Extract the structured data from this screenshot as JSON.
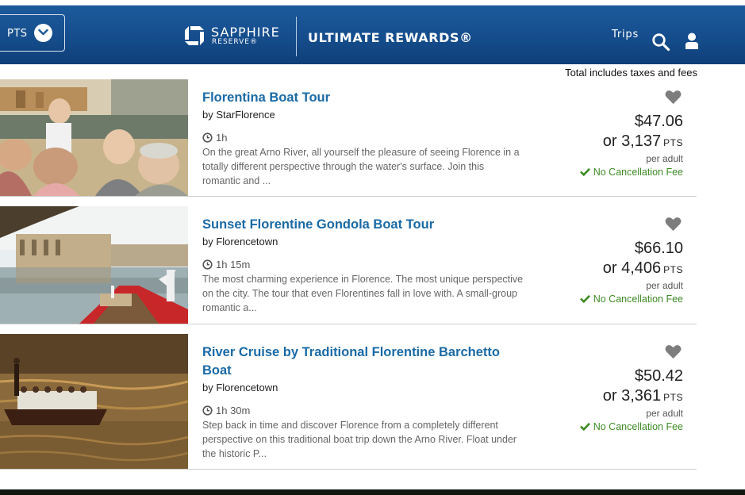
{
  "header": {
    "currency_label": "PTS",
    "brand_line1": "SAPPHIRE",
    "brand_line2": "RESERVE®",
    "program_name": "ULTIMATE REWARDS®",
    "trips_label": "Trips"
  },
  "results": {
    "taxes_note": "Total includes taxes and fees",
    "items": [
      {
        "title": "Florentina Boat Tour",
        "vendor": "by StarFlorence",
        "duration": "1h",
        "description": "On the great Arno River, all yourself the pleasure of seeing Florence in a totally different perspective through the water's surface. Join this romantic and ...",
        "price": "$47.06",
        "points": "or 3,137",
        "points_unit": "PTS",
        "per": "per adult",
        "cancellation": "No Cancellation Fee"
      },
      {
        "title": "Sunset Florentine Gondola Boat Tour",
        "vendor": "by Florencetown",
        "duration": "1h 15m",
        "description": "The most charming experience in Florence. The most unique perspective on the city. The tour that even Florentines fall in love with. A small-group romantic a...",
        "price": "$66.10",
        "points": "or 4,406",
        "points_unit": "PTS",
        "per": "per adult",
        "cancellation": "No Cancellation Fee"
      },
      {
        "title": "River Cruise by Traditional Florentine Barchetto Boat",
        "vendor": "by Florencetown",
        "duration": "1h 30m",
        "description": "Step back in time and discover Florence from a completely different perspective on this traditional boat trip down the Arno River. Float under the historic P...",
        "price": "$50.42",
        "points": "or 3,361",
        "points_unit": "PTS",
        "per": "per adult",
        "cancellation": "No Cancellation Fee"
      }
    ]
  },
  "colors": {
    "header_blue": "#154d8c",
    "title_link": "#1a6aa6",
    "no_fee_green": "#3d8b24",
    "heart_gray": "#7d7d7d"
  },
  "icons": [
    "chevron-down-icon",
    "sapphire-logo-icon",
    "search-icon",
    "user-icon",
    "clock-icon",
    "heart-icon",
    "check-icon"
  ]
}
